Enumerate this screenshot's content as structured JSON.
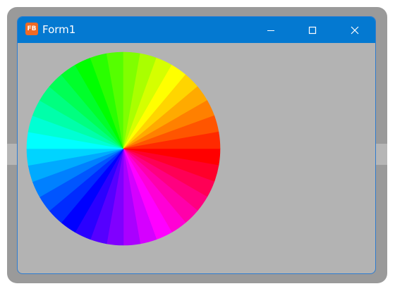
{
  "window": {
    "title": "Form1",
    "icon": "freebasic-icon",
    "titlebar_color": "#0479d1",
    "client_color": "#b3b3b3",
    "controls": [
      "minimize-icon",
      "maximize-icon",
      "close-icon"
    ]
  },
  "color_wheel": {
    "segments": 36,
    "first_segment_hue_deg": 0,
    "hue_direction": "clockwise"
  }
}
